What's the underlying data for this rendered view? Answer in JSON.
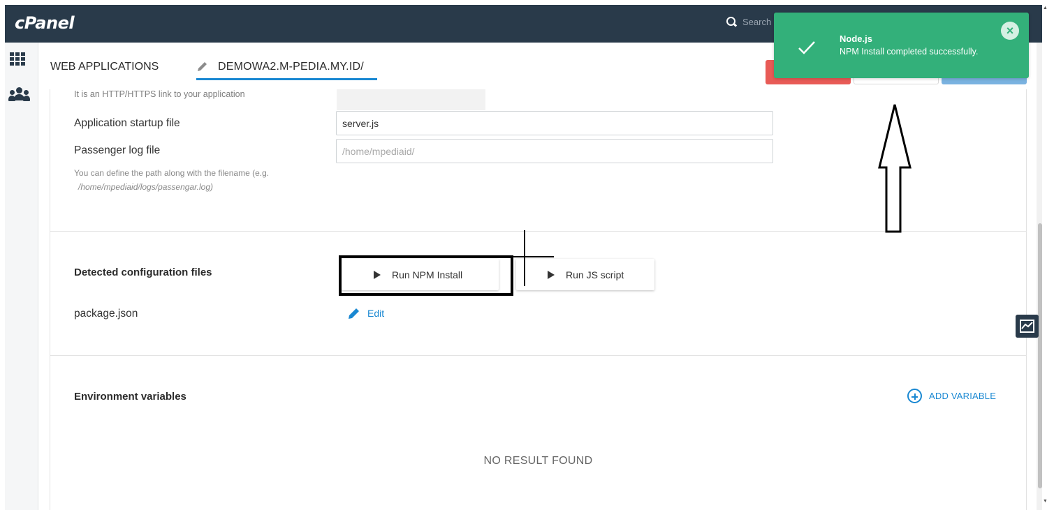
{
  "topbar": {
    "logo": "cPanel",
    "search_placeholder": "Search"
  },
  "header": {
    "breadcrumb_root": "WEB APPLICATIONS",
    "app_title": "DEMOWA2.M-PEDIA.MY.ID/"
  },
  "form": {
    "url_hint": "It is an HTTP/HTTPS link to your application",
    "startup_label": "Application startup file",
    "startup_value": "server.js",
    "log_label": "Passenger log file",
    "log_placeholder": "/home/mpediaid/",
    "log_help": "You can define the path along with the filename (e.g.",
    "log_help_example": "/home/mpediaid/logs/passengar.log)"
  },
  "config": {
    "title": "Detected configuration files",
    "run_npm_label": "Run NPM Install",
    "run_js_label": "Run JS script",
    "file_name": "package.json",
    "edit_label": "Edit"
  },
  "env": {
    "title": "Environment variables",
    "add_label": "ADD VARIABLE",
    "empty_text": "NO RESULT FOUND"
  },
  "toast": {
    "title": "Node.js",
    "message": "NPM Install completed successfully.",
    "close_symbol": "×"
  },
  "colors": {
    "topbar": "#293a4a",
    "accent": "#1a88d2",
    "toast": "#33b07a",
    "danger": "#e85b56"
  }
}
